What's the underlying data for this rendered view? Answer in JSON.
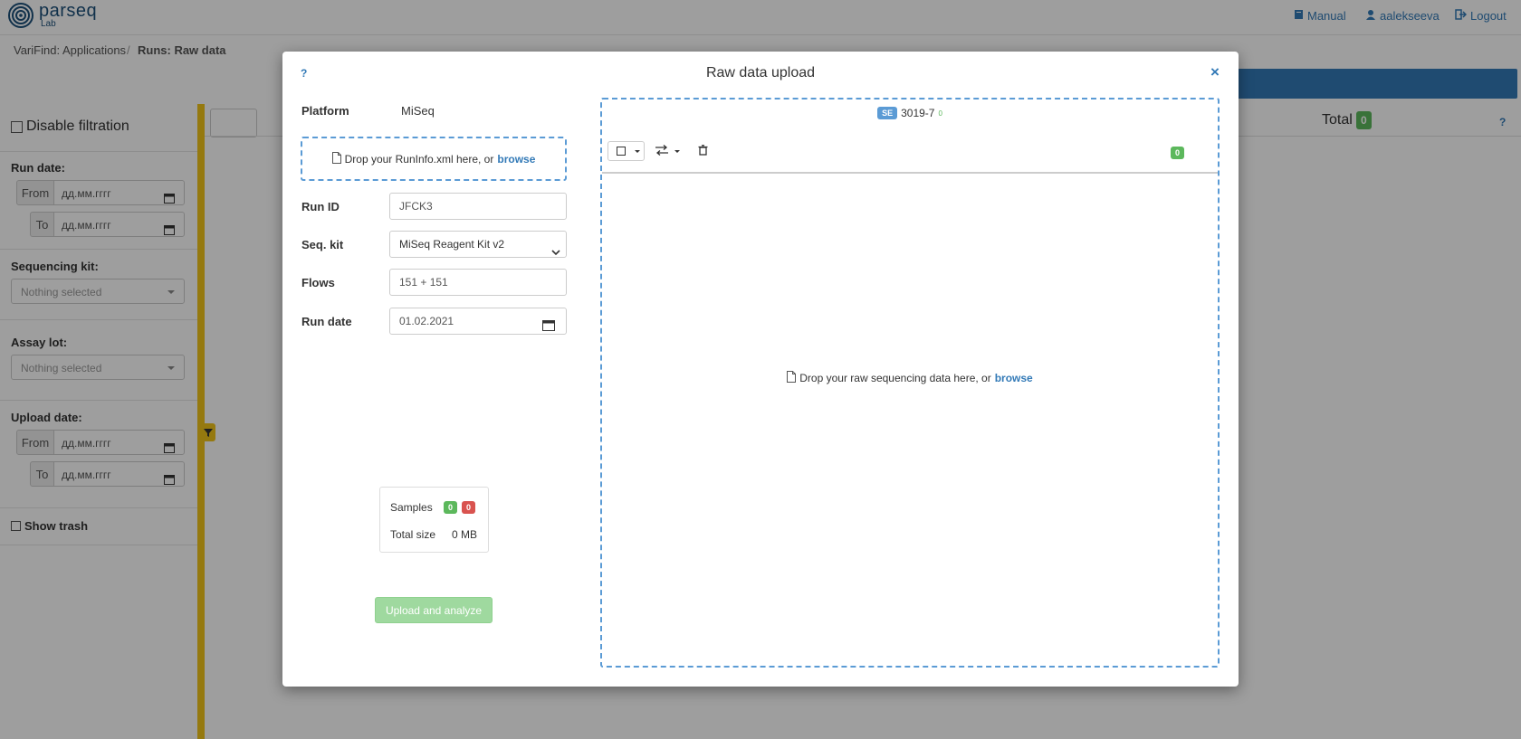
{
  "header": {
    "logo_text": "parseq",
    "logo_sub": "Lab",
    "manual": "Manual",
    "user": "aalekseeva",
    "logout": "Logout"
  },
  "breadcrumb": {
    "root": "VariFind: Applications",
    "separator": "/",
    "current": "Runs: Raw data"
  },
  "background": {
    "total_label": "Total",
    "total_count": "0",
    "help": "?"
  },
  "sidebar": {
    "disable_filtration": "Disable filtration",
    "run_date": "Run date:",
    "from": "From",
    "to": "To",
    "date_placeholder": "дд.мм.гггг",
    "sequencing_kit": "Sequencing kit:",
    "nothing_selected": "Nothing selected",
    "assay_lot": "Assay lot:",
    "upload_date": "Upload date:",
    "show_trash": "Show trash"
  },
  "modal": {
    "help": "?",
    "title": "Raw data upload",
    "close": "×",
    "platform_label": "Platform",
    "platform_value": "MiSeq",
    "runinfo_drop": "Drop your RunInfo.xml here, or",
    "browse": "browse",
    "run_id_label": "Run ID",
    "run_id_value": "JFCK3",
    "seq_kit_label": "Seq. kit",
    "seq_kit_value": "MiSeq Reagent Kit v2",
    "flows_label": "Flows",
    "flows_value": "151 + 151",
    "run_date_label": "Run date",
    "run_date_value": "01.02.2021",
    "samples_label": "Samples",
    "samples_green": "0",
    "samples_red": "0",
    "total_size_label": "Total size",
    "total_size_value": "0 MB",
    "upload_button": "Upload and analyze",
    "se_badge": "SE",
    "run_tag": "3019-7",
    "run_tag_sup": "0",
    "file_count": "0",
    "raw_drop": "Drop your raw sequencing data here, or"
  },
  "colors": {
    "accent": "#337ab7",
    "success": "#5cb85c",
    "danger": "#d9534f",
    "filter_bar": "#f0c419"
  }
}
